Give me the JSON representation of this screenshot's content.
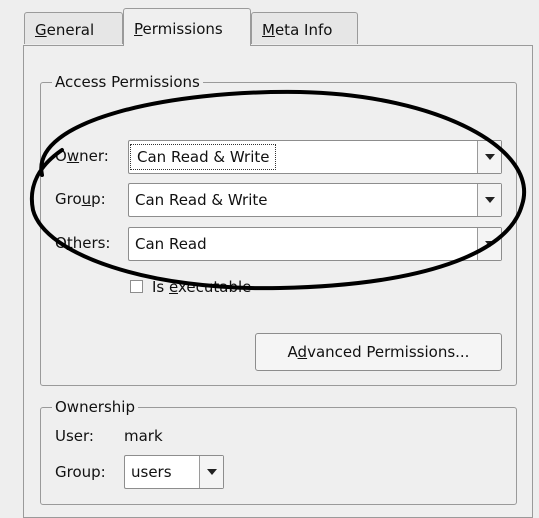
{
  "tabs": {
    "general": {
      "pre": "",
      "key": "G",
      "post": "eneral"
    },
    "permissions": {
      "pre": "",
      "key": "P",
      "post": "ermissions"
    },
    "meta": {
      "pre": "",
      "key": "M",
      "post": "eta Info"
    }
  },
  "access": {
    "title": "Access Permissions",
    "owner_label": {
      "pre": "O",
      "key": "w",
      "post": "ner:"
    },
    "owner_value": "Can Read & Write",
    "group_label": {
      "pre": "Gro",
      "key": "u",
      "post": "p:"
    },
    "group_value": "Can Read & Write",
    "others_label": {
      "pre": "O",
      "key": "t",
      "post": "hers:"
    },
    "others_value": "Can Read",
    "executable": {
      "pre": "Is ",
      "key": "e",
      "post": "xecutable",
      "checked": false
    },
    "advanced_button": {
      "pre": "A",
      "key": "d",
      "post": "vanced Permissions..."
    }
  },
  "ownership": {
    "title": "Ownership",
    "user_label": "User:",
    "user_value": "mark",
    "group_label": "Group:",
    "group_value": "users"
  }
}
